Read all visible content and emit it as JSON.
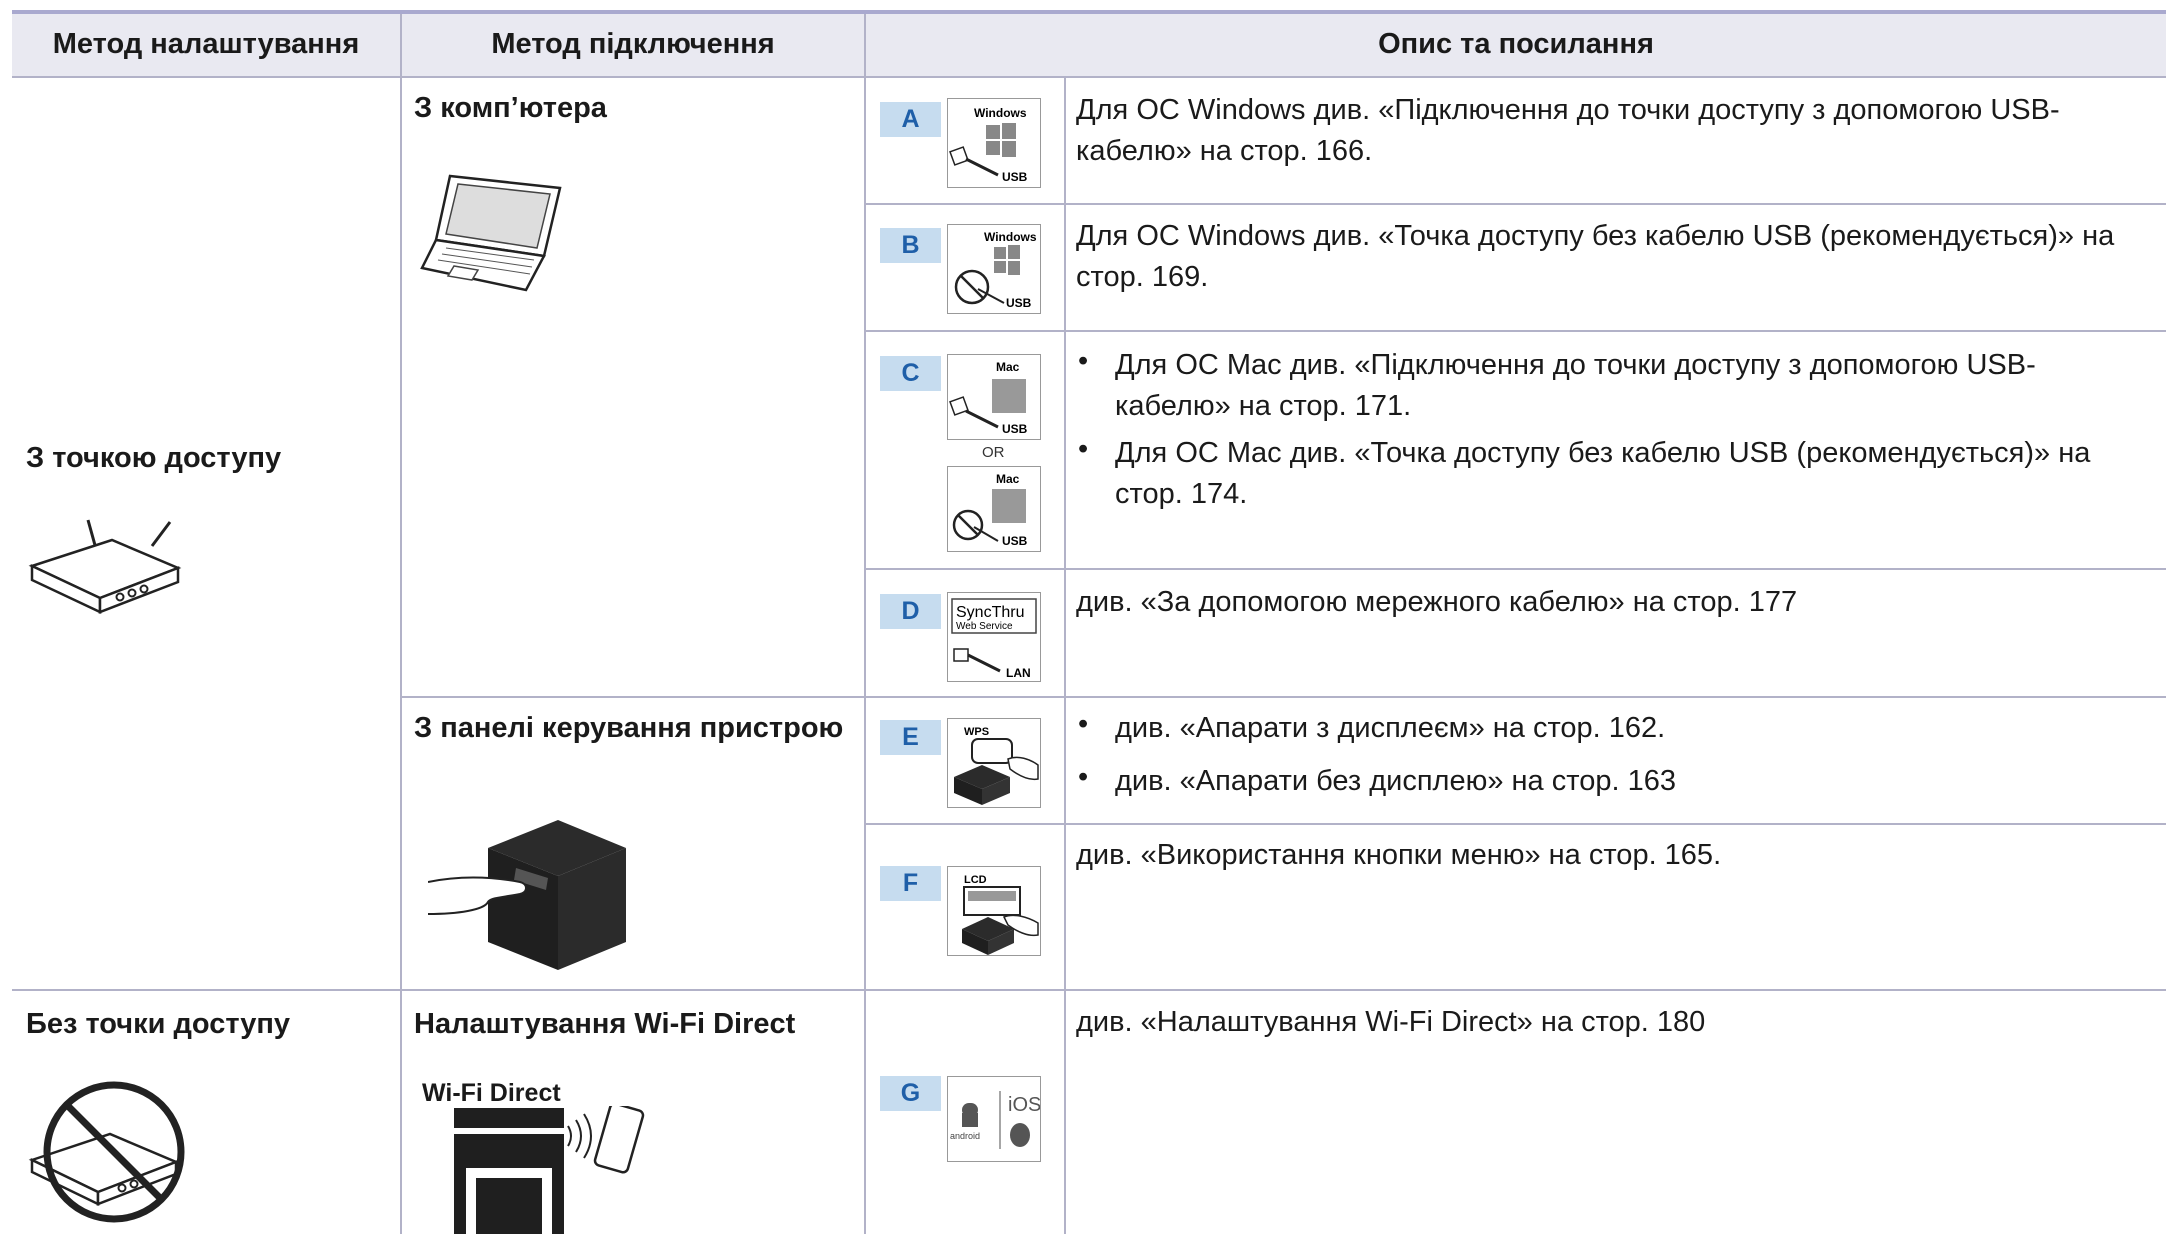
{
  "headers": {
    "setup_method": "Метод налаштування",
    "connection_method": "Метод підключення",
    "description": "Опис та посилання"
  },
  "rows": {
    "with_ap": {
      "label": "З точкою доступу",
      "from_computer": "З комп’ютера",
      "from_panel": "З панелі керування пристрою"
    },
    "without_ap": {
      "label": "Без точки доступу",
      "wifi_direct": "Налаштування Wi-Fi Direct"
    }
  },
  "entries": {
    "a": {
      "badge": "A",
      "text": "Для ОС Windows див. «Підключення до точки доступу з допомогою USB-кабелю» на стор. 166."
    },
    "b": {
      "badge": "B",
      "text": "Для ОС Windows див. «Точка доступу без кабелю USB (рекомендується)» на стор. 169."
    },
    "c": {
      "badge": "C",
      "or": "OR",
      "bullets": [
        "Для ОС Mac див. «Підключення до точки доступу з допомогою USB-кабелю» на стор. 171.",
        "Для ОС Mac див. «Точка доступу без кабелю USB (рекомендується)» на стор. 174."
      ]
    },
    "d": {
      "badge": "D",
      "text": "див. «За допомогою мережного кабелю» на стор. 177"
    },
    "e": {
      "badge": "E",
      "bullets": [
        "див. «Апарати з дисплеєм» на стор. 162.",
        "див. «Апарати без дисплею» на стор. 163"
      ]
    },
    "f": {
      "badge": "F",
      "text": "див. «Використання кнопки меню» на стор. 165."
    },
    "g": {
      "badge": "G",
      "text": "див. «Налаштування Wi-Fi Direct» на стор. 180"
    }
  },
  "icon_labels": {
    "windows": "Windows",
    "mac": "Mac",
    "usb": "USB",
    "lan": "LAN",
    "syncthru": "SyncThru",
    "web_service": "Web Service",
    "wps": "WPS",
    "lcd": "LCD",
    "ios": "iOS",
    "android": "android",
    "wifi_direct": "Wi-Fi Direct"
  },
  "colors": {
    "header_band": "#e9e9f1",
    "badge_bg": "#c6dcef",
    "badge_text": "#1f5fa8",
    "rule": "#b2b2c8"
  }
}
